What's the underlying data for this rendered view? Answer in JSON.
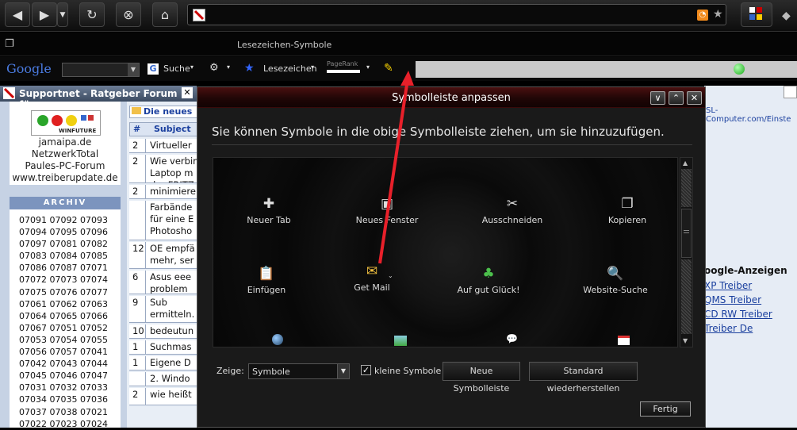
{
  "nav": {
    "url": ""
  },
  "bookmarks_bar": {
    "title": "Lesezeichen-Symbole"
  },
  "google_toolbar": {
    "logo": "Google",
    "search_label": "Suche",
    "bookmarks_label": "Lesezeichen",
    "pagerank_label": "PageRank"
  },
  "background_page": {
    "tab_title": "Supportnet - Ratgeber Forum für...",
    "sponsors": [
      "jamaipa.de",
      "NetzwerkTotal",
      "Paules-PC-Forum",
      "www.treiberupdate.de"
    ],
    "sponsor_logo_text": "WINFUTURE",
    "archive_header": "ARCHIV",
    "archive_rows": [
      "07091 07092 07093",
      "07094 07095 07096",
      "07097 07081 07082",
      "07083 07084 07085",
      "07086 07087 07071",
      "07072 07073 07074",
      "07075 07076 07077",
      "07061 07062 07063",
      "07064 07065 07066",
      "07067 07051 07052",
      "07053 07054 07055",
      "07056 07057 07041",
      "07042 07043 07044",
      "07045 07046 07047",
      "07031 07032 07033",
      "07034 07035 07036",
      "07037 07038 07021",
      "07022 07023 07024"
    ],
    "table_title": "Die neues",
    "table_headers": [
      "#",
      "Subject"
    ],
    "table_rows": [
      {
        "n": "2",
        "s": "Virtueller"
      },
      {
        "n": "2",
        "s": "Wie verbin Laptop m der FRITZ"
      },
      {
        "n": "2",
        "s": "minimiere"
      },
      {
        "n": "",
        "s": "Farbände für eine E Photosho"
      },
      {
        "n": "12",
        "s": "OE empfä mehr, ser"
      },
      {
        "n": "6",
        "s": "Asus eee problem"
      },
      {
        "n": "9",
        "s": "Sub ermitteln."
      },
      {
        "n": "10",
        "s": "bedeutun"
      },
      {
        "n": "1",
        "s": "Suchmas"
      },
      {
        "n": "1",
        "s": "Eigene D"
      },
      {
        "n": "",
        "s": "2. Windo"
      },
      {
        "n": "2",
        "s": "wie heißt"
      }
    ],
    "right_url": "SL-Computer.com/Einste",
    "ads_header": "oogle-Anzeigen",
    "ads_links": [
      "XP Treiber",
      "QMS Treiber",
      "CD RW Treiber",
      "Treiber De"
    ]
  },
  "dialog": {
    "title": "Symbolleiste anpassen",
    "message": "Sie können Symbole in die obige Symbolleiste ziehen, um sie hinzuzufügen.",
    "items": [
      {
        "label": "Neuer Tab",
        "icon": "new-tab-icon",
        "glyph": "✚"
      },
      {
        "label": "Neues Fenster",
        "icon": "new-window-icon",
        "glyph": "▣"
      },
      {
        "label": "Ausschneiden",
        "icon": "scissors-icon",
        "glyph": "✂"
      },
      {
        "label": "Kopieren",
        "icon": "copy-icon",
        "glyph": "❐"
      },
      {
        "label": "Einfügen",
        "icon": "paste-icon",
        "glyph": "📋"
      },
      {
        "label": "Get Mail",
        "icon": "mail-icon",
        "glyph": "✉"
      },
      {
        "label": "Auf gut Glück!",
        "icon": "clover-icon",
        "glyph": "♣"
      },
      {
        "label": "Website-Suche",
        "icon": "search-icon",
        "glyph": "🔍"
      }
    ],
    "show_label": "Zeige:",
    "show_value": "Symbole",
    "small_icons_label": "kleine Symbole",
    "small_icons_checked": true,
    "new_toolbar_button": "Neue Symbolleiste",
    "restore_button": "Standard wiederherstellen",
    "done_button": "Fertig"
  },
  "colors": {
    "arrow": "#e8202a",
    "title_bar": "#3a0c0c",
    "link": "#1a3f9e"
  }
}
